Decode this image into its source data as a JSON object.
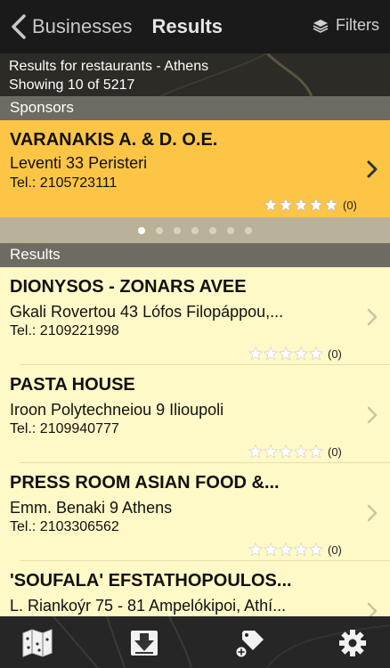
{
  "nav": {
    "back_label": "Businesses",
    "title": "Results",
    "filters_label": "Filters"
  },
  "summary": {
    "query_text": "Results for restaurants - Athens",
    "showing_text": "Showing 10 of 5217"
  },
  "sponsors": {
    "header": "Sponsors",
    "item": {
      "name": "VARANAKIS A. & D. O.E.",
      "address": "Leventi 33 Peristeri",
      "tel": "Tel.: 2105723111",
      "rating_count": "(0)",
      "rating": 0
    },
    "pager": {
      "pages": 7,
      "active": 1
    }
  },
  "results": {
    "header": "Results",
    "items": [
      {
        "name": "DIONYSOS - ZONARS AVEE",
        "address": "Gkali Rovertou 43 Lófos Filopáppou,...",
        "tel": "Tel.: 2109221998",
        "rating_count": "(0)",
        "rating": 0
      },
      {
        "name": "PASTA HOUSE",
        "address": "Iroon Polytechneiou 9 Ilioupoli",
        "tel": "Tel.: 2109940777",
        "rating_count": "(0)",
        "rating": 0
      },
      {
        "name": "PRESS ROOM ASIAN FOOD &...",
        "address": "Emm. Benaki 9 Athens",
        "tel": "Tel.: 2103306562",
        "rating_count": "(0)",
        "rating": 0
      },
      {
        "name": "'SOUFALA' EFSTATHOPOULOS...",
        "address": "L. Riankoýr 75 - 81 Ampelókipoi, Athí...",
        "tel": "",
        "rating_count": "",
        "rating": 0
      }
    ]
  },
  "tabbar": {
    "icons": [
      "map-icon",
      "download-icon",
      "tag-add-icon",
      "settings-gear-icon"
    ]
  },
  "colors": {
    "sponsor_bg": "#fcc545",
    "result_bg": "#fff9c7",
    "header_bg": "#6e6c62",
    "navbar_bg": "#1a1a1a"
  }
}
